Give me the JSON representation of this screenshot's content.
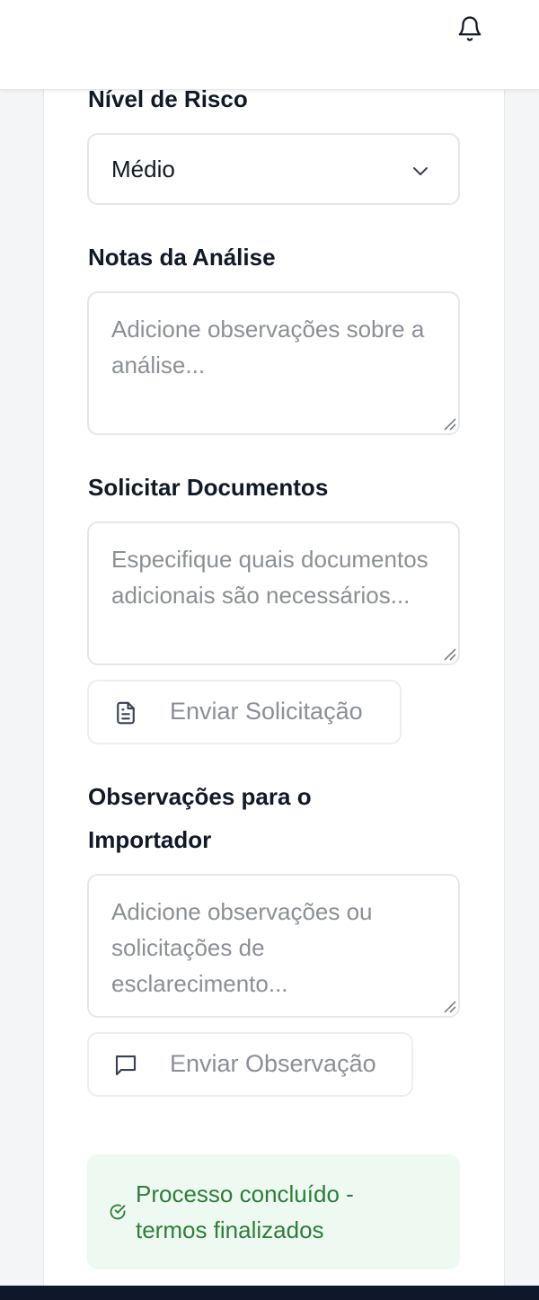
{
  "header": {
    "notification_icon": "bell-icon"
  },
  "risk": {
    "label": "Nível de Risco",
    "selected": "Médio"
  },
  "analysis_notes": {
    "label": "Notas da Análise",
    "placeholder": "Adicione observações sobre a análise..."
  },
  "documents": {
    "label": "Solicitar Documentos",
    "placeholder": "Especifique quais documentos adicionais são necessários...",
    "button_label": "Enviar Solicitação",
    "button_icon": "document-icon"
  },
  "importer_notes": {
    "label_line1": "Observações para o",
    "label_line2": "Importador",
    "placeholder": "Adicione observações ou solicitações de esclarecimento...",
    "button_label": "Enviar Observação",
    "button_icon": "message-icon"
  },
  "status": {
    "text_line1": "Processo concluído -",
    "text_line2": "termos finalizados",
    "icon": "check-circle-icon",
    "color": "#2f7d3a",
    "background": "#eefaf1"
  }
}
